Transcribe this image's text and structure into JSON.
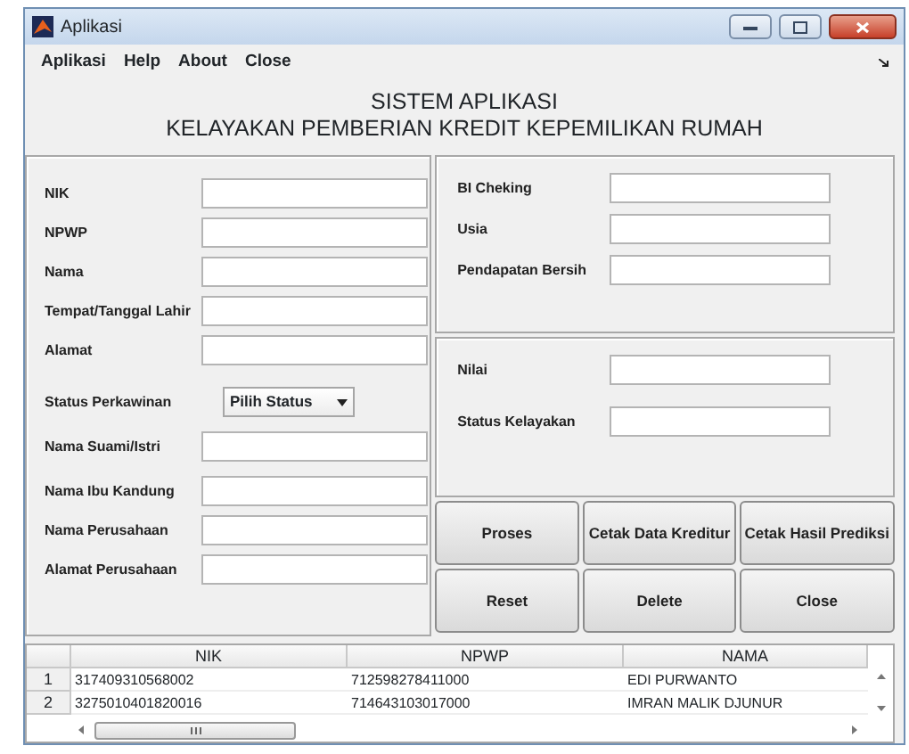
{
  "window": {
    "title": "Aplikasi"
  },
  "menu": [
    "Aplikasi",
    "Help",
    "About",
    "Close"
  ],
  "heading": [
    "SISTEM APLIKASI",
    "KELAYAKAN PEMBERIAN KREDIT KEPEMILIKAN RUMAH"
  ],
  "personal_fields": [
    {
      "label": "NIK",
      "kind": "text"
    },
    {
      "label": "NPWP",
      "kind": "text"
    },
    {
      "label": "Nama",
      "kind": "text"
    },
    {
      "label": "Tempat/Tanggal Lahir",
      "kind": "text"
    },
    {
      "label": "Alamat",
      "kind": "text"
    },
    {
      "label": "Status Perkawinan",
      "kind": "select",
      "value": "Pilih Status"
    },
    {
      "label": "Nama Suami/Istri",
      "kind": "text"
    },
    {
      "label": "Nama Ibu Kandung",
      "kind": "text"
    },
    {
      "label": "Nama Perusahaan",
      "kind": "text"
    },
    {
      "label": "Alamat Perusahaan",
      "kind": "text"
    }
  ],
  "credit_fields": [
    {
      "label": "BI Cheking"
    },
    {
      "label": "Usia"
    },
    {
      "label": "Pendapatan Bersih"
    }
  ],
  "result_fields": [
    {
      "label": "Nilai"
    },
    {
      "label": "Status Kelayakan"
    }
  ],
  "buttons": [
    "Proses",
    "Cetak Data Kreditur",
    "Cetak Hasil Prediksi",
    "Reset",
    "Delete",
    "Close"
  ],
  "table": {
    "columns": [
      "NIK",
      "NPWP",
      "NAMA"
    ],
    "rows": [
      {
        "number": "1",
        "cells": [
          "317409310568002",
          "712598278411000",
          "EDI PURWANTO"
        ]
      },
      {
        "number": "2",
        "cells": [
          "3275010401820016",
          "714643103017000",
          "IMRAN MALIK DJUNUR"
        ]
      }
    ]
  }
}
